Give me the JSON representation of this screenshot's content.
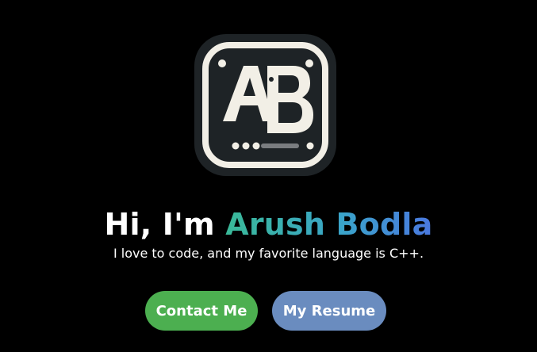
{
  "logo": {
    "text": "AB",
    "icon": "ab-monogram-logo"
  },
  "hero": {
    "greeting": "Hi, I'm ",
    "name": "Arush Bodla",
    "tagline": "I love to code, and my favorite language is C++."
  },
  "actions": {
    "contact_label": "Contact Me",
    "resume_label": "My Resume"
  },
  "colors": {
    "background": "#000000",
    "contact_button": "#4caf50",
    "resume_button": "#6a8cbf",
    "name_gradient_start": "#3ab998",
    "name_gradient_end": "#4a78e0"
  }
}
